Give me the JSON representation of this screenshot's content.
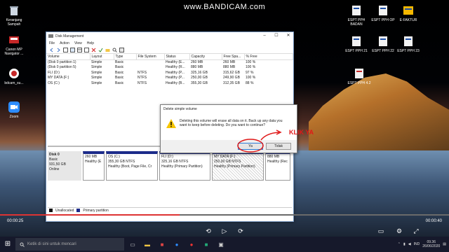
{
  "watermark": "www.BANDICAM.com",
  "desktop_icons_left": [
    {
      "label": "Keranjang Sampah",
      "icon": "recycle-bin-icon"
    },
    {
      "label": "Canon MP Navigator ...",
      "icon": "canon-icon"
    },
    {
      "label": "bdcam_su...",
      "icon": "bandicam-icon"
    },
    {
      "label": "Zoom",
      "icon": "zoom-icon"
    }
  ],
  "desktop_icons_right": [
    {
      "label": "ESPT PPH BADAN",
      "icon": "espt-icon"
    },
    {
      "label": "ESPT PPH OP",
      "icon": "espt-icon"
    },
    {
      "label": "E-FAKTUR",
      "icon": "efaktur-icon"
    },
    {
      "label": "ESPT PPH 21",
      "icon": "espt-icon"
    },
    {
      "label": "ESPT PPH 22",
      "icon": "espt-icon"
    },
    {
      "label": "ESPT PPH 23",
      "icon": "espt-icon"
    },
    {
      "label": "ESPT PPH 4.2",
      "icon": "espt-icon"
    }
  ],
  "window": {
    "title": "Disk Management",
    "menu": [
      "File",
      "Action",
      "View",
      "Help"
    ],
    "columns": [
      "Volume",
      "Layout",
      "Type",
      "File System",
      "Status",
      "Capacity",
      "Free Spa...",
      "% Free"
    ],
    "rows": [
      [
        "(Disk 0 partition 1)",
        "Simple",
        "Basic",
        "",
        "Healthy (E...",
        "260 MB",
        "260 MB",
        "100 %"
      ],
      [
        "(Disk 0 partition 5)",
        "Simple",
        "Basic",
        "",
        "Healthy (R...",
        "880 MB",
        "880 MB",
        "100 %"
      ],
      [
        "FLI (D:)",
        "Simple",
        "Basic",
        "NTFS",
        "Healthy (P...",
        "325,16 GB",
        "315,62 GB",
        "97 %"
      ],
      [
        "MY DATA (F:)",
        "Simple",
        "Basic",
        "NTFS",
        "Healthy (P...",
        "250,00 GB",
        "249,90 GB",
        "100 %"
      ],
      [
        "OS (C:)",
        "Simple",
        "Basic",
        "NTFS",
        "Healthy (B...",
        "355,30 GB",
        "312,35 GB",
        "88 %"
      ]
    ],
    "disk": {
      "name": "Disk 0",
      "type": "Basic",
      "size": "931,50 GB",
      "state": "Online",
      "partitions": [
        {
          "title": "",
          "size": "260 MB",
          "status": "Healthy (E"
        },
        {
          "title": "OS  (C:)",
          "size": "355,30 GB NTFS",
          "status": "Healthy (Boot, Page File, Cr"
        },
        {
          "title": "FLI  (D:)",
          "size": "325,16 GB NTFS",
          "status": "Healthy (Primary Partition)"
        },
        {
          "title": "MY DATA  (F:)",
          "size": "250,00 GB NTFS",
          "status": "Healthy (Primary Partition)"
        },
        {
          "title": "",
          "size": "880 MB",
          "status": "Healthy (Rec"
        }
      ]
    },
    "legend": [
      "Unallocated",
      "Primary partition"
    ]
  },
  "dialog": {
    "title": "Delete simple volume",
    "message": "Deleting this volume will erase all data on it. Back up any data you want to keep before deleting. Do you want to continue?",
    "yes": "Ya",
    "no": "Tidak"
  },
  "annotation": "KLIK YA",
  "player": {
    "elapsed": "00:00:25",
    "total": "00:00:40",
    "progress": 0.4
  },
  "taskbar": {
    "search_placeholder": "Ketik di sini untuk mencari",
    "language": "IND",
    "time": "09.36",
    "date": "26/06/2020"
  }
}
